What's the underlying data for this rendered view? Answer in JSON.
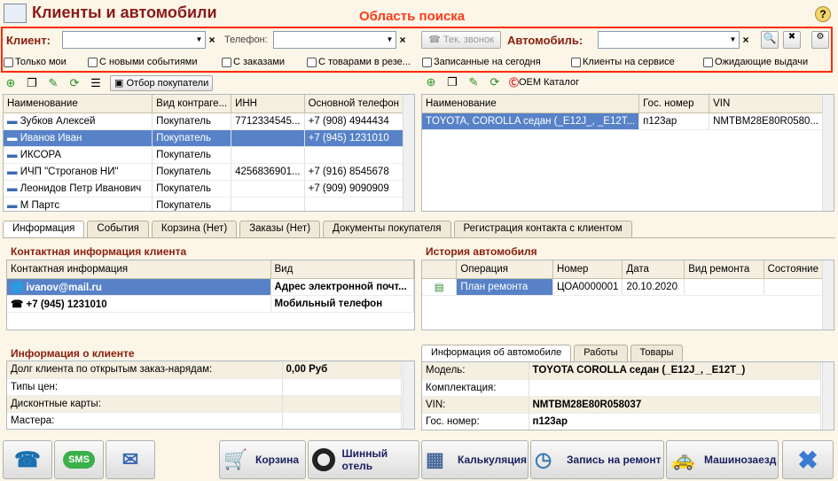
{
  "window": {
    "title": "Клиенты и автомобили",
    "help_label": "?"
  },
  "search": {
    "caption": "Область поиска",
    "client_label": "Клиент:",
    "phone_label": "Телефон:",
    "call_button": "Тек. звонок",
    "car_label": "Автомобиль:",
    "filters": [
      "Только мои",
      "С новыми событиями",
      "С заказами",
      "С товарами в резе...",
      "Записанные на сегодня",
      "Клиенты на сервисе",
      "Ожидающие выдачи"
    ]
  },
  "clients_toolbar": {
    "select_buyers": "Отбор покупатели"
  },
  "cars_toolbar": {
    "oem_catalog": "OEM Каталог"
  },
  "clients_table": {
    "columns": [
      "Наименование",
      "Вид контраге...",
      "ИНН",
      "Основной телефон"
    ],
    "rows": [
      [
        "Зубков Алексей",
        "Покупатель",
        "7712334545...",
        "+7 (908) 4944434"
      ],
      [
        "Иванов Иван",
        "Покупатель",
        "",
        "+7 (945) 1231010"
      ],
      [
        "ИКСОРА",
        "Покупатель",
        "",
        ""
      ],
      [
        "ИЧП \"Строганов НИ\"",
        "Покупатель",
        "4256836901...",
        "+7 (916) 8545678"
      ],
      [
        "Леонидов Петр Иванович",
        "Покупатель",
        "",
        "+7 (909) 9090909"
      ],
      [
        "М Партс",
        "Покупатель",
        "",
        ""
      ]
    ]
  },
  "cars_table": {
    "columns": [
      "Наименование",
      "Гос. номер",
      "VIN"
    ],
    "rows": [
      [
        "TOYOTA, COROLLA седан (_E12J_, _E12T...",
        "п123ар",
        "NMTBM28E80R0580..."
      ]
    ]
  },
  "main_tabs": [
    "Информация",
    "События",
    "Корзина (Нет)",
    "Заказы (Нет)",
    "Документы покупателя",
    "Регистрация контакта с клиентом"
  ],
  "contact_info": {
    "title": "Контактная информация клиента",
    "columns": [
      "Контактная информация",
      "Вид"
    ],
    "rows": [
      [
        "ivanov@mail.ru",
        "Адрес электронной почт..."
      ],
      [
        "+7 (945) 1231010",
        "Мобильный телефон"
      ]
    ]
  },
  "car_history": {
    "title": "История автомобиля",
    "columns": [
      "Операция",
      "Номер",
      "Дата",
      "Вид ремонта",
      "Состояние"
    ],
    "rows": [
      [
        "План ремонта",
        "ЦОА0000001",
        "20.10.2020",
        "",
        ""
      ]
    ]
  },
  "client_info": {
    "title": "Информация о клиенте",
    "rows": [
      [
        "Долг клиента по открытым заказ-нарядам:",
        "0,00 Руб"
      ],
      [
        "Типы цен:",
        ""
      ],
      [
        "Дисконтные карты:",
        ""
      ],
      [
        "Мастера:",
        ""
      ]
    ]
  },
  "car_tabs": [
    "Информация об автомобиле",
    "Работы",
    "Товары"
  ],
  "car_info": {
    "rows": [
      [
        "Модель:",
        "TOYOTA COROLLA седан (_E12J_, _E12T_)"
      ],
      [
        "Комплектация:",
        ""
      ],
      [
        "VIN:",
        "NMTBM28E80R058037"
      ],
      [
        "Гос. номер:",
        "п123ар"
      ]
    ]
  },
  "bottom_buttons": [
    "Корзина",
    "Шинный отель",
    "Калькуляция",
    "Запись на ремонт",
    "Машинозаезд"
  ],
  "sms_label": "SMS"
}
